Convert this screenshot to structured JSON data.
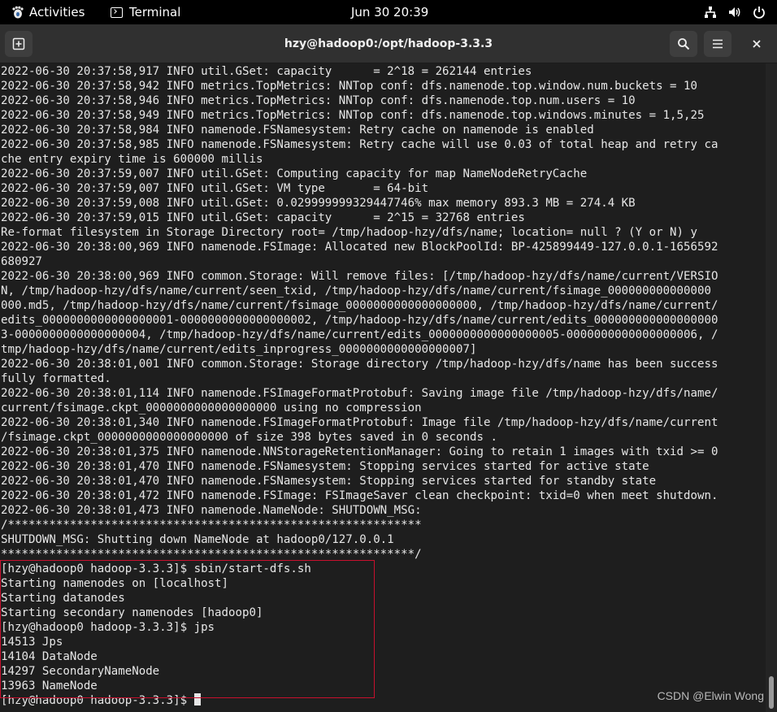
{
  "topbar": {
    "activities_label": "Activities",
    "app_label": "Terminal",
    "clock": "Jun 30  20:39"
  },
  "window": {
    "title": "hzy@hadoop0:/opt/hadoop-3.3.3"
  },
  "terminal": {
    "lines": [
      "2022-06-30 20:37:58,917 INFO util.GSet: capacity      = 2^18 = 262144 entries",
      "2022-06-30 20:37:58,942 INFO metrics.TopMetrics: NNTop conf: dfs.namenode.top.window.num.buckets = 10",
      "2022-06-30 20:37:58,946 INFO metrics.TopMetrics: NNTop conf: dfs.namenode.top.num.users = 10",
      "2022-06-30 20:37:58,949 INFO metrics.TopMetrics: NNTop conf: dfs.namenode.top.windows.minutes = 1,5,25",
      "2022-06-30 20:37:58,984 INFO namenode.FSNamesystem: Retry cache on namenode is enabled",
      "2022-06-30 20:37:58,985 INFO namenode.FSNamesystem: Retry cache will use 0.03 of total heap and retry ca",
      "che entry expiry time is 600000 millis",
      "2022-06-30 20:37:59,007 INFO util.GSet: Computing capacity for map NameNodeRetryCache",
      "2022-06-30 20:37:59,007 INFO util.GSet: VM type       = 64-bit",
      "2022-06-30 20:37:59,008 INFO util.GSet: 0.029999999329447746% max memory 893.3 MB = 274.4 KB",
      "2022-06-30 20:37:59,015 INFO util.GSet: capacity      = 2^15 = 32768 entries",
      "Re-format filesystem in Storage Directory root= /tmp/hadoop-hzy/dfs/name; location= null ? (Y or N) y",
      "2022-06-30 20:38:00,969 INFO namenode.FSImage: Allocated new BlockPoolId: BP-425899449-127.0.0.1-1656592",
      "680927",
      "2022-06-30 20:38:00,969 INFO common.Storage: Will remove files: [/tmp/hadoop-hzy/dfs/name/current/VERSIO",
      "N, /tmp/hadoop-hzy/dfs/name/current/seen_txid, /tmp/hadoop-hzy/dfs/name/current/fsimage_000000000000000",
      "000.md5, /tmp/hadoop-hzy/dfs/name/current/fsimage_0000000000000000000, /tmp/hadoop-hzy/dfs/name/current/",
      "edits_0000000000000000001-0000000000000000002, /tmp/hadoop-hzy/dfs/name/current/edits_000000000000000000",
      "3-0000000000000000004, /tmp/hadoop-hzy/dfs/name/current/edits_0000000000000000005-0000000000000000006, /",
      "tmp/hadoop-hzy/dfs/name/current/edits_inprogress_0000000000000000007]",
      "2022-06-30 20:38:01,001 INFO common.Storage: Storage directory /tmp/hadoop-hzy/dfs/name has been success",
      "fully formatted.",
      "2022-06-30 20:38:01,114 INFO namenode.FSImageFormatProtobuf: Saving image file /tmp/hadoop-hzy/dfs/name/",
      "current/fsimage.ckpt_0000000000000000000 using no compression",
      "2022-06-30 20:38:01,340 INFO namenode.FSImageFormatProtobuf: Image file /tmp/hadoop-hzy/dfs/name/current",
      "/fsimage.ckpt_0000000000000000000 of size 398 bytes saved in 0 seconds .",
      "2022-06-30 20:38:01,375 INFO namenode.NNStorageRetentionManager: Going to retain 1 images with txid >= 0",
      "2022-06-30 20:38:01,470 INFO namenode.FSNamesystem: Stopping services started for active state",
      "2022-06-30 20:38:01,470 INFO namenode.FSNamesystem: Stopping services started for standby state",
      "2022-06-30 20:38:01,472 INFO namenode.FSImage: FSImageSaver clean checkpoint: txid=0 when meet shutdown.",
      "2022-06-30 20:38:01,473 INFO namenode.NameNode: SHUTDOWN_MSG:",
      "/************************************************************",
      "SHUTDOWN_MSG: Shutting down NameNode at hadoop0/127.0.0.1",
      "************************************************************/",
      "[hzy@hadoop0 hadoop-3.3.3]$ sbin/start-dfs.sh",
      "Starting namenodes on [localhost]",
      "Starting datanodes",
      "Starting secondary namenodes [hadoop0]",
      "[hzy@hadoop0 hadoop-3.3.3]$ jps",
      "14513 Jps",
      "14104 DataNode",
      "14297 SecondaryNameNode",
      "13963 NameNode"
    ],
    "prompt": "[hzy@hadoop0 hadoop-3.3.3]$ "
  },
  "watermark": "CSDN @Elwin Wong",
  "icons": {
    "activities": "gnome-foot-icon",
    "app": "terminal-icon",
    "network": "network-icon",
    "volume": "volume-icon",
    "power": "power-icon",
    "new_tab": "new-tab-icon",
    "search": "search-icon",
    "menu": "hamburger-menu-icon",
    "close": "close-icon"
  },
  "colors": {
    "terminal_bg": "#1e1e1e",
    "terminal_fg": "#e6e6e6",
    "highlight_border": "#c8102e"
  }
}
